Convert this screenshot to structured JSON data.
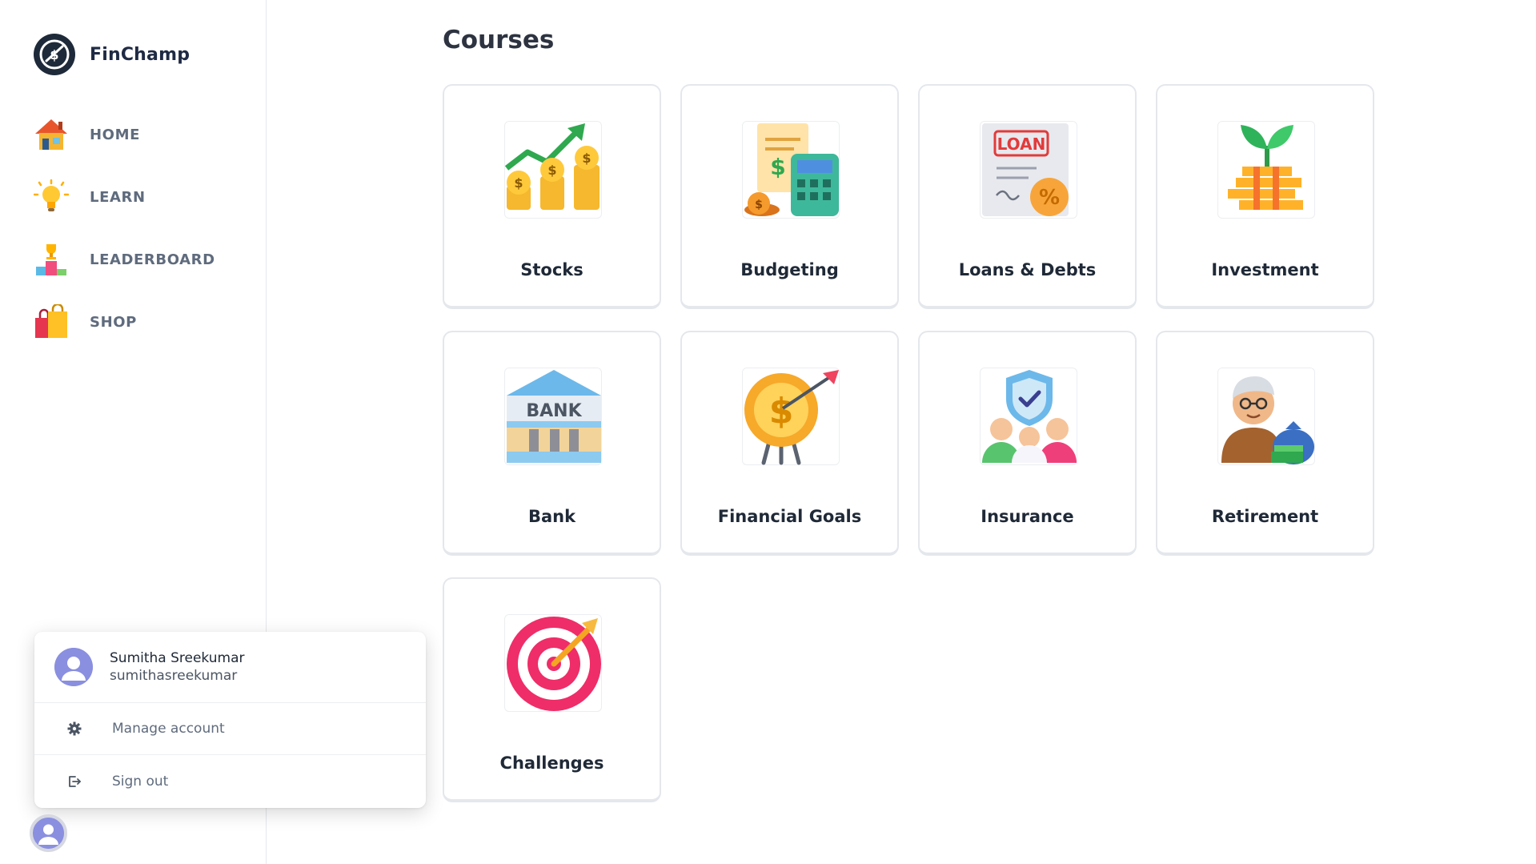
{
  "brand": {
    "name": "FinChamp"
  },
  "nav": {
    "items": [
      {
        "label": "HOME",
        "icon": "house-icon"
      },
      {
        "label": "LEARN",
        "icon": "lightbulb-icon"
      },
      {
        "label": "LEADERBOARD",
        "icon": "podium-trophy-icon"
      },
      {
        "label": "SHOP",
        "icon": "shopping-bags-icon"
      }
    ]
  },
  "page": {
    "title": "Courses"
  },
  "courses": [
    {
      "label": "Stocks",
      "icon": "stocks-icon"
    },
    {
      "label": "Budgeting",
      "icon": "budgeting-icon"
    },
    {
      "label": "Loans & Debts",
      "icon": "loan-icon"
    },
    {
      "label": "Investment",
      "icon": "investment-plant-icon"
    },
    {
      "label": "Bank",
      "icon": "bank-icon"
    },
    {
      "label": "Financial Goals",
      "icon": "dollar-target-icon"
    },
    {
      "label": "Insurance",
      "icon": "insurance-shield-icon"
    },
    {
      "label": "Retirement",
      "icon": "retirement-icon"
    },
    {
      "label": "Challenges",
      "icon": "target-dart-icon"
    }
  ],
  "user": {
    "name": "Sumitha Sreekumar",
    "username": "sumithasreekumar",
    "menu": [
      {
        "label": "Manage account",
        "icon": "gear-icon"
      },
      {
        "label": "Sign out",
        "icon": "sign-out-icon"
      }
    ]
  }
}
